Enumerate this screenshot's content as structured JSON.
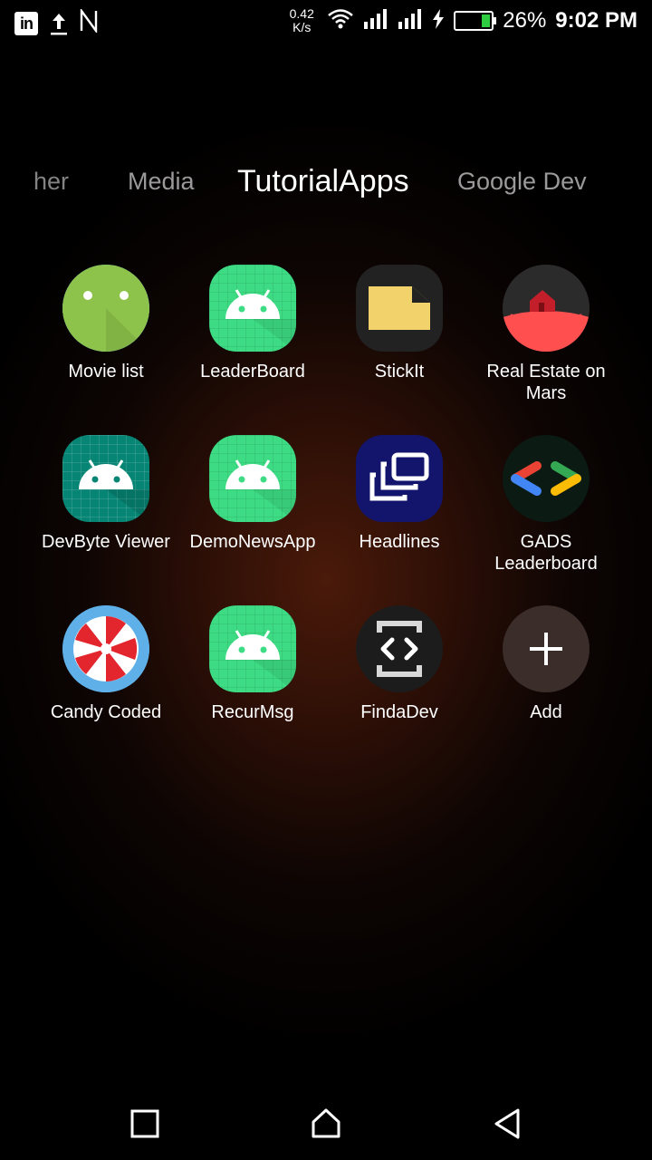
{
  "status_bar": {
    "net_speed_value": "0.42",
    "net_speed_unit": "K/s",
    "battery_percent": "26%",
    "battery_level": 0.26,
    "time": "9:02 PM",
    "left_icons": [
      "linkedin-icon",
      "upload-icon",
      "n-notification-icon"
    ],
    "right_icons": [
      "wifi-icon",
      "signal-icon",
      "signal-icon",
      "charging-icon",
      "battery-icon"
    ]
  },
  "tabs": [
    {
      "label": "her",
      "state": "partial"
    },
    {
      "label": "Media",
      "state": "inactive"
    },
    {
      "label": "TutorialApps",
      "state": "active"
    },
    {
      "label": "Google Dev",
      "state": "inactive"
    }
  ],
  "apps": [
    {
      "label": "Movie list",
      "icon": "android-robot-icon"
    },
    {
      "label": "LeaderBoard",
      "icon": "android-robot-icon"
    },
    {
      "label": "StickIt",
      "icon": "sticky-note-icon"
    },
    {
      "label": "Real Estate on Mars",
      "icon": "mars-house-icon"
    },
    {
      "label": "DevByte Viewer",
      "icon": "android-robot-icon"
    },
    {
      "label": "DemoNewsApp",
      "icon": "android-robot-icon"
    },
    {
      "label": "Headlines",
      "icon": "stacked-windows-icon"
    },
    {
      "label": "GADS Leaderboard",
      "icon": "google-dev-brackets-icon"
    },
    {
      "label": "Candy Coded",
      "icon": "peppermint-candy-icon"
    },
    {
      "label": "RecurMsg",
      "icon": "android-robot-icon"
    },
    {
      "label": "FindaDev",
      "icon": "code-brackets-icon"
    },
    {
      "label": "Add",
      "icon": "plus-icon"
    }
  ],
  "nav_bar": {
    "buttons": [
      "recents-icon",
      "home-icon",
      "back-icon"
    ]
  },
  "colors": {
    "android_green": "#3ddc84",
    "battery_green": "#2ecc40",
    "mars_red": "#ff4f4f",
    "stickit_yellow": "#f2d26b"
  }
}
